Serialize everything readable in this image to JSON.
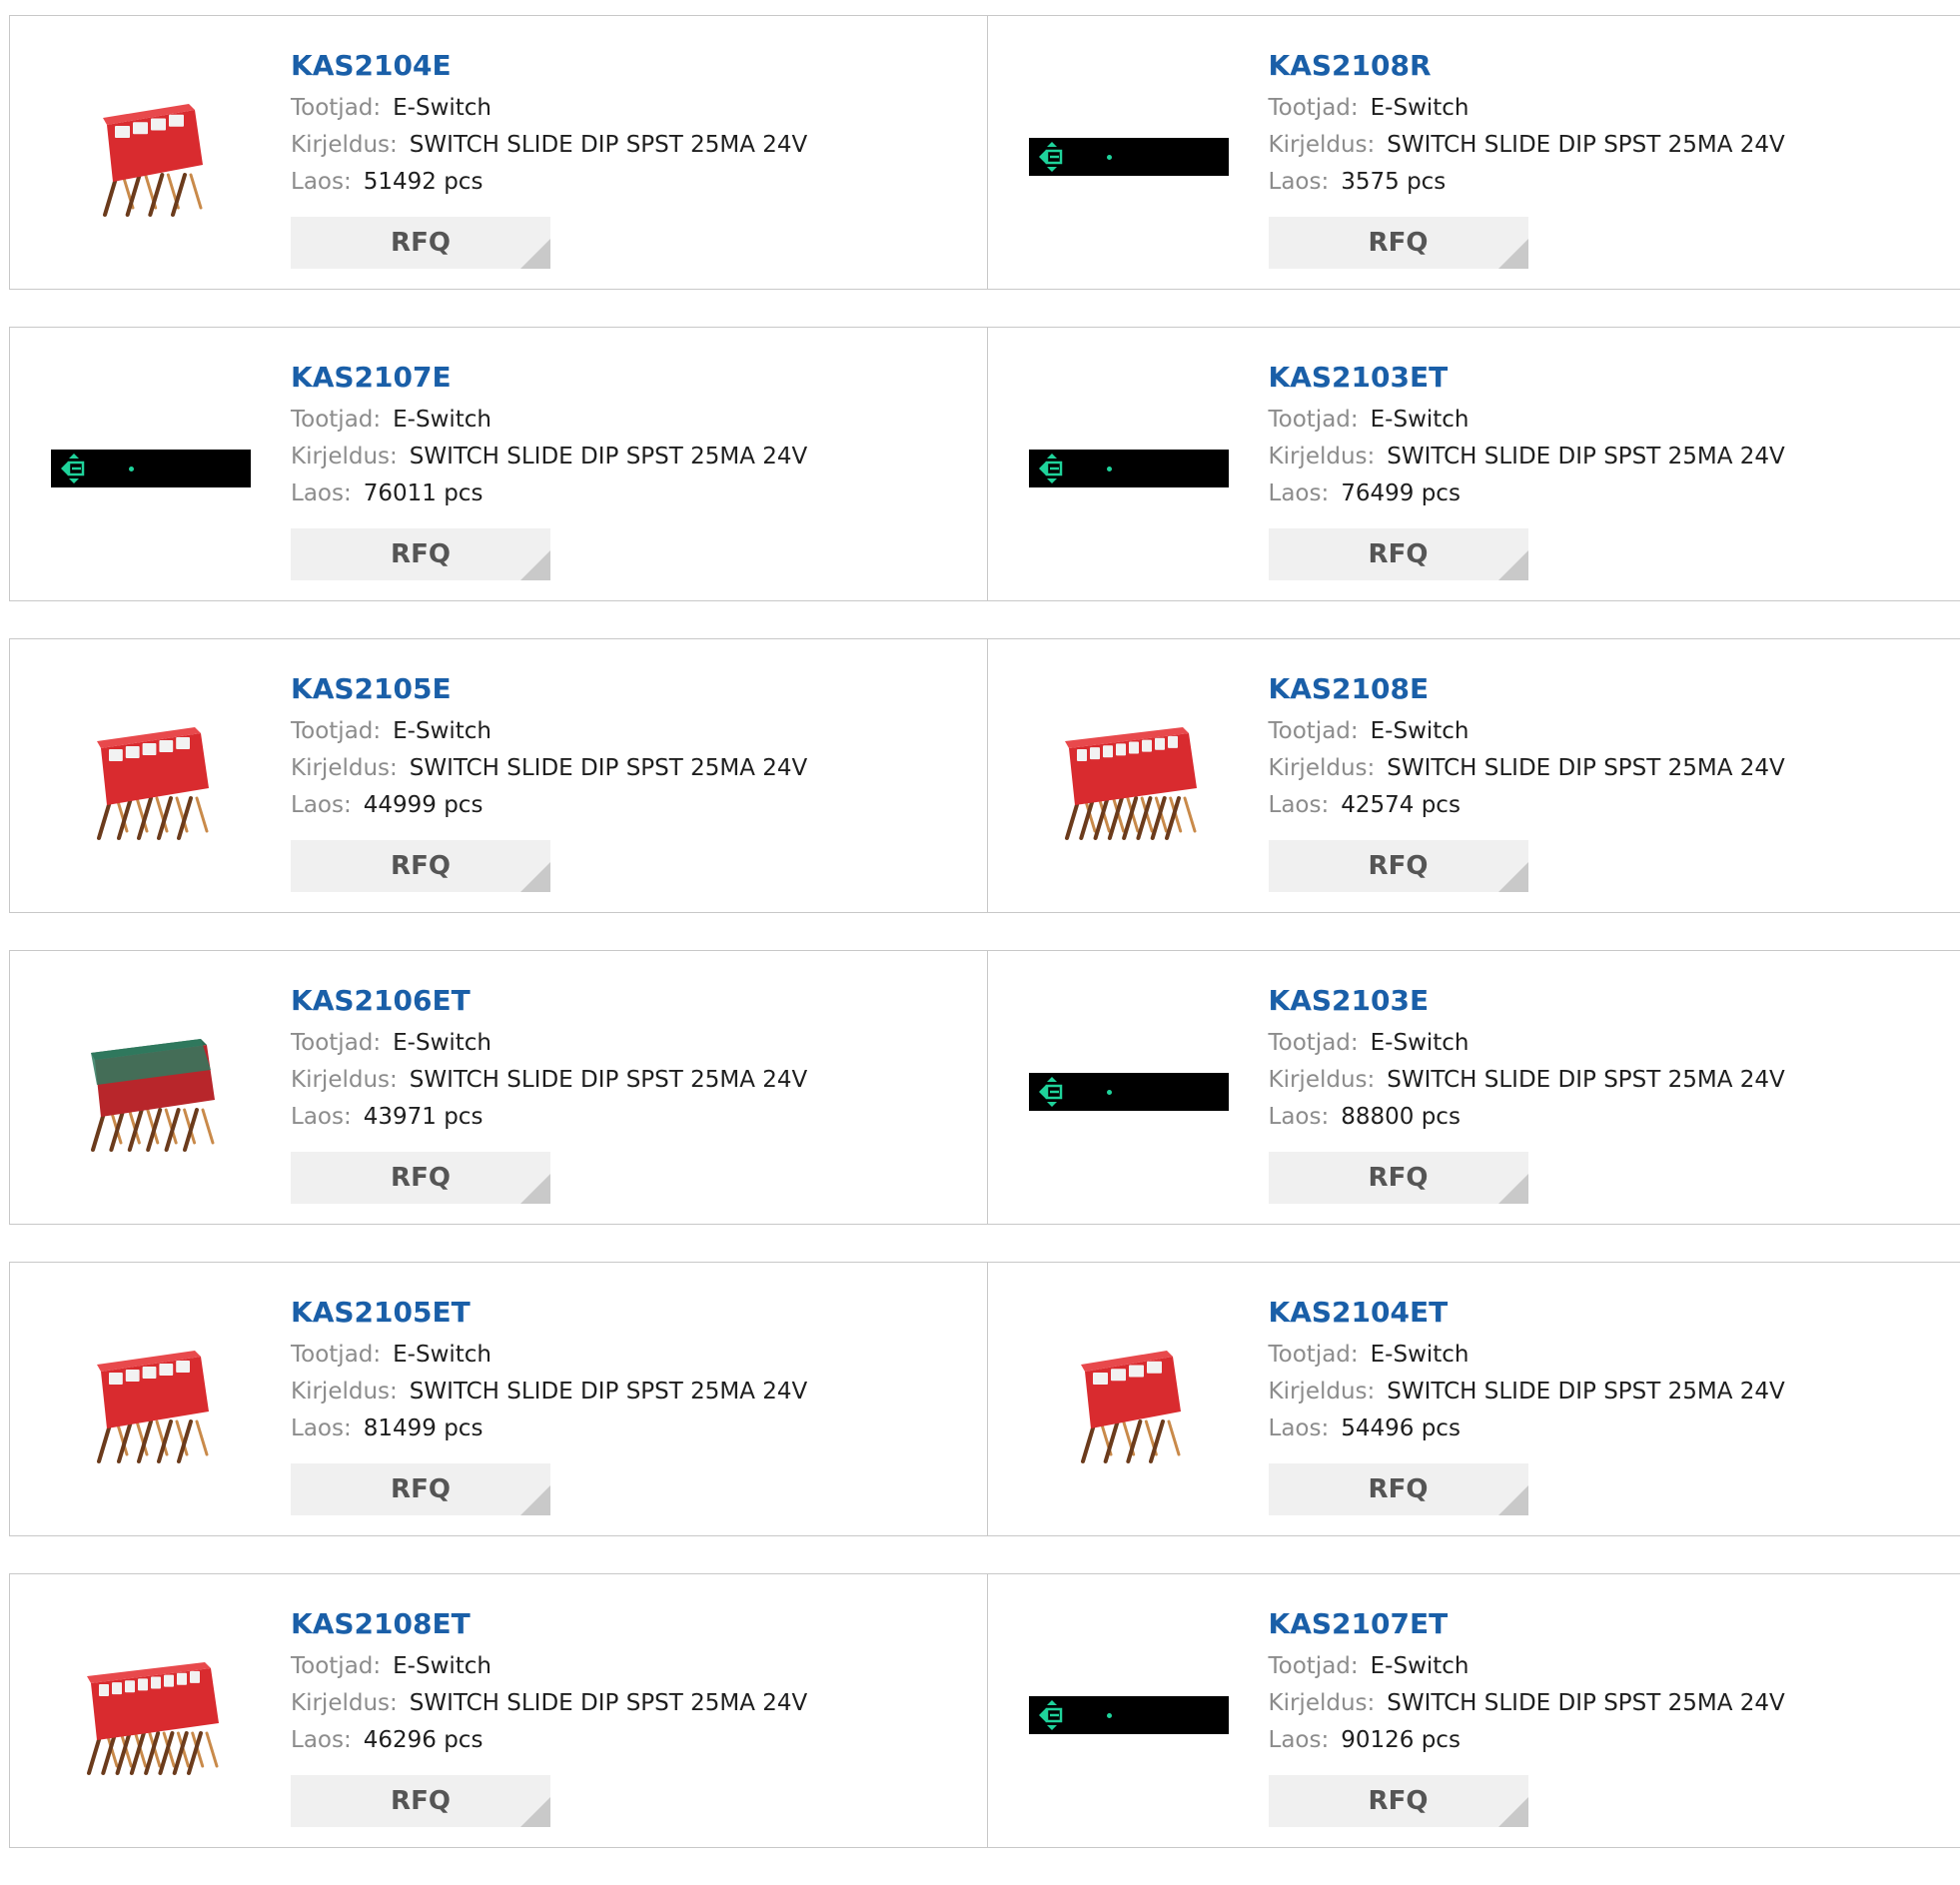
{
  "labels": {
    "manufacturer": "Tootjad:",
    "description": "Kirjeldus:",
    "stock": "Laos:",
    "rfq": "RFQ"
  },
  "colors": {
    "link": "#1a5fa8",
    "label": "#8c8c8c",
    "border": "#c8c8c8",
    "button_bg": "#f0f0f0"
  },
  "products": [
    {
      "part": "KAS2104E",
      "manufacturer": "E-Switch",
      "description": "SWITCH SLIDE DIP SPST 25MA 24V",
      "stock": "51492 pcs",
      "image": "dip-switch-4-icon"
    },
    {
      "part": "KAS2108R",
      "manufacturer": "E-Switch",
      "description": "SWITCH SLIDE DIP SPST 25MA 24V",
      "stock": "3575 pcs",
      "image": "placeholder-icon"
    },
    {
      "part": "KAS2107E",
      "manufacturer": "E-Switch",
      "description": "SWITCH SLIDE DIP SPST 25MA 24V",
      "stock": "76011 pcs",
      "image": "placeholder-icon"
    },
    {
      "part": "KAS2103ET",
      "manufacturer": "E-Switch",
      "description": "SWITCH SLIDE DIP SPST 25MA 24V",
      "stock": "76499 pcs",
      "image": "placeholder-icon"
    },
    {
      "part": "KAS2105E",
      "manufacturer": "E-Switch",
      "description": "SWITCH SLIDE DIP SPST 25MA 24V",
      "stock": "44999 pcs",
      "image": "dip-switch-5-icon"
    },
    {
      "part": "KAS2108E",
      "manufacturer": "E-Switch",
      "description": "SWITCH SLIDE DIP SPST 25MA 24V",
      "stock": "42574 pcs",
      "image": "dip-switch-8-icon"
    },
    {
      "part": "KAS2106ET",
      "manufacturer": "E-Switch",
      "description": "SWITCH SLIDE DIP SPST 25MA 24V",
      "stock": "43971 pcs",
      "image": "dip-switch-6-sealed-icon"
    },
    {
      "part": "KAS2103E",
      "manufacturer": "E-Switch",
      "description": "SWITCH SLIDE DIP SPST 25MA 24V",
      "stock": "88800 pcs",
      "image": "placeholder-icon"
    },
    {
      "part": "KAS2105ET",
      "manufacturer": "E-Switch",
      "description": "SWITCH SLIDE DIP SPST 25MA 24V",
      "stock": "81499 pcs",
      "image": "dip-switch-5-icon"
    },
    {
      "part": "KAS2104ET",
      "manufacturer": "E-Switch",
      "description": "SWITCH SLIDE DIP SPST 25MA 24V",
      "stock": "54496 pcs",
      "image": "dip-switch-4-icon"
    },
    {
      "part": "KAS2108ET",
      "manufacturer": "E-Switch",
      "description": "SWITCH SLIDE DIP SPST 25MA 24V",
      "stock": "46296 pcs",
      "image": "dip-switch-8-icon"
    },
    {
      "part": "KAS2107ET",
      "manufacturer": "E-Switch",
      "description": "SWITCH SLIDE DIP SPST 25MA 24V",
      "stock": "90126 pcs",
      "image": "placeholder-icon"
    }
  ]
}
